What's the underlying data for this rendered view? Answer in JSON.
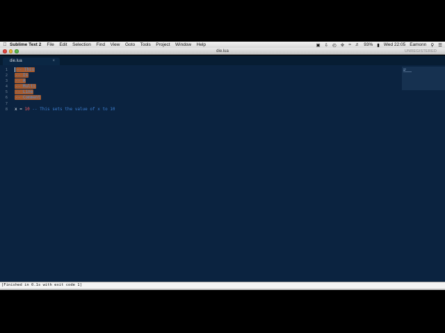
{
  "menubar": {
    "apple_icon": "apple-icon",
    "app_name": "Sublime Text 2",
    "items": [
      "File",
      "Edit",
      "Selection",
      "Find",
      "View",
      "Goto",
      "Tools",
      "Project",
      "Window",
      "Help"
    ],
    "status": {
      "battery_percent": "93%",
      "clock": "Wed 22:05",
      "user": "Eamonn"
    }
  },
  "window": {
    "title": "die.lua",
    "unregistered_label": "UNREGISTERED"
  },
  "tabs": [
    {
      "label": "die.lua",
      "close": "×"
    }
  ],
  "editor": {
    "line_numbers": [
      "1",
      "2",
      "3",
      "4",
      "5",
      "6",
      "7",
      "8"
    ],
    "selected_lines": [
      "-- This",
      "-- Is",
      "-- A",
      "-- Multi",
      "-- Line",
      "-- Comment"
    ],
    "code_line": {
      "var": "x",
      "op": " = ",
      "num": "10",
      "comment": " -- This sets the value of x to 10"
    }
  },
  "output": {
    "text": "[Finished in 0.1s with exit code 1]"
  },
  "colors": {
    "editor_bg": "#0b2340",
    "selection": "#a45a2f",
    "comment": "#3d7fd1",
    "number": "#ff5f5f"
  }
}
